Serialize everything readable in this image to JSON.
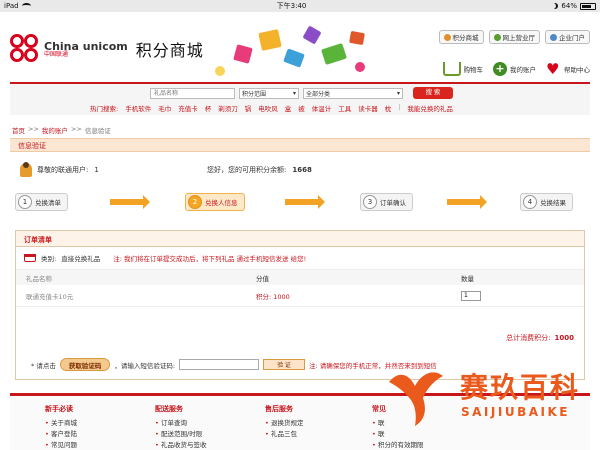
{
  "status_bar": {
    "device": "iPad",
    "time": "下午3:40",
    "battery": "64%"
  },
  "header": {
    "logo_en": "China unicom",
    "logo_cn": "中国联通",
    "site_title": "积分商城",
    "top_links": [
      "积分商城",
      "网上营业厅",
      "企业门户"
    ],
    "user_links": [
      "购物车",
      "我的账户",
      "帮助中心"
    ]
  },
  "search": {
    "placeholder": "礼品名称",
    "range_label": "积分范围",
    "category_label": "全部分类",
    "button_label": "搜 索",
    "hot_label": "热门搜索:",
    "hot_items": [
      "手机软件",
      "毛巾",
      "充值卡",
      "杯",
      "剃须刀",
      "锅",
      "电吹风",
      "盒",
      "被",
      "体温计",
      "工具",
      "读卡器",
      "枕"
    ],
    "can_redeem": "我能兑换的礼品"
  },
  "breadcrumb": {
    "home": "首页",
    "account": "我的账户",
    "current": "信息验证",
    "sep": ">>"
  },
  "section_title": "信息验证",
  "user": {
    "label": "尊敬的联通用户:",
    "count": "1",
    "balance_label": "您好，您的可用积分余额:",
    "balance": "1668"
  },
  "steps": [
    {
      "num": "1",
      "label": "兑换清单"
    },
    {
      "num": "2",
      "label": "兑换人信息"
    },
    {
      "num": "3",
      "label": "订单确认"
    },
    {
      "num": "4",
      "label": "兑换结果"
    }
  ],
  "order": {
    "title": "订单清单",
    "category_label": "类别:",
    "category_value": "直接兑换礼品",
    "note": "注: 我们将在订单提交成功后，将下列礼品  通过手机短信发送  给您!",
    "col_name": "礼品名称",
    "col_points": "分值",
    "col_qty": "数量",
    "item_name": "联通充值卡10元",
    "item_points": "积分: 1000",
    "item_qty": "1",
    "total_label": "总计消费积分:",
    "total_value": "1000",
    "verify_label": "* 请点击",
    "get_code": "获取验证码",
    "sms_label": "，请输入短信验证码:",
    "confirm": "验 证",
    "hint": "注: 请确保您的手机正常，并然否来到到短信"
  },
  "footer": {
    "columns": [
      {
        "title": "新手必读",
        "items": [
          "关于商城",
          "客户登陆",
          "常见问题"
        ]
      },
      {
        "title": "配送服务",
        "items": [
          "订单查询",
          "配送范围/时限",
          "礼品收货与签收"
        ]
      },
      {
        "title": "售后服务",
        "items": [
          "退换货规定",
          "礼品三包"
        ]
      },
      {
        "title": "常见",
        "items": [
          "联",
          "联",
          "积分的有效期限"
        ]
      }
    ]
  },
  "watermark": {
    "title": "赛玖百科",
    "subtitle": "SAIJIUBAIKE"
  },
  "colors": {
    "brand": "#c8161d",
    "accent": "#f3a323",
    "watermark": "#ea5a1c"
  }
}
